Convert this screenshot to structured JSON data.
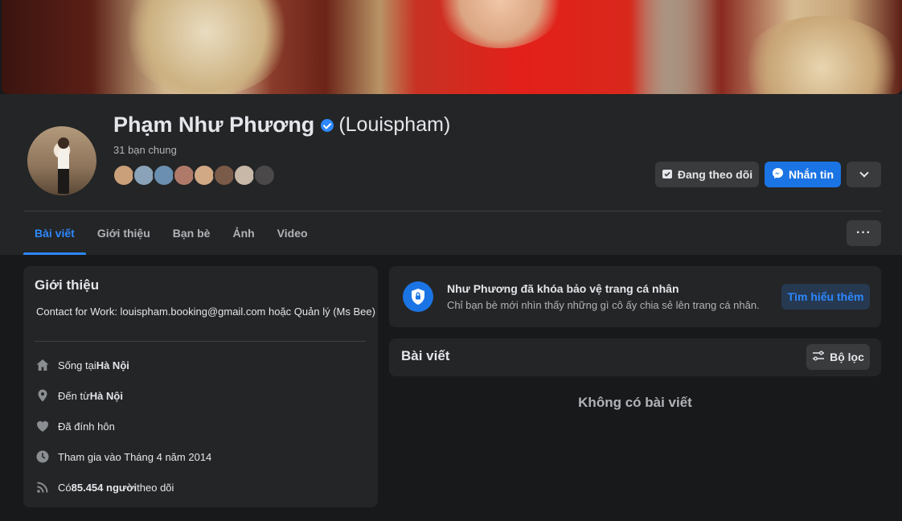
{
  "profile": {
    "name": "Phạm Như Phương",
    "alternate_name": "(Louispham)",
    "mutual_friends": "31 bạn chung",
    "mutual_avatars": [
      "#c9a07a",
      "#8aa3b8",
      "#6b8fb0",
      "#b07a6a",
      "#d1a985",
      "#7a5a48",
      "#c8b8a8",
      "#4a4848"
    ]
  },
  "actions": {
    "follow_label": "Đang theo dõi",
    "message_label": "Nhắn tin"
  },
  "tabs": [
    {
      "label": "Bài viết"
    },
    {
      "label": "Giới thiệu"
    },
    {
      "label": "Bạn bè"
    },
    {
      "label": "Ảnh"
    },
    {
      "label": "Video"
    }
  ],
  "tab_more_label": "···",
  "intro": {
    "title": "Giới thiệu",
    "bio": "Contact for Work: louispham.booking@gmail.com hoặc Quản lý (Ms Bee)",
    "items": [
      {
        "icon": "home-icon",
        "prefix": "Sống tại ",
        "bold": "Hà Nội",
        "suffix": ""
      },
      {
        "icon": "location-pin-icon",
        "prefix": "Đến từ ",
        "bold": "Hà Nội",
        "suffix": ""
      },
      {
        "icon": "heart-icon",
        "prefix": "Đã đính hôn",
        "bold": "",
        "suffix": ""
      },
      {
        "icon": "clock-icon",
        "prefix": "Tham gia vào Tháng 4 năm 2014",
        "bold": "",
        "suffix": ""
      },
      {
        "icon": "rss-icon",
        "prefix": "Có ",
        "bold": "85.454 người",
        "suffix": " theo dõi"
      }
    ]
  },
  "locked_notice": {
    "title": "Như Phương đã khóa bảo vệ trang cá nhân",
    "subtitle": "Chỉ bạn bè mới nhìn thấy những gì cô ấy chia sẻ lên trang cá nhân.",
    "button_label": "Tìm hiểu thêm"
  },
  "posts": {
    "title": "Bài viết",
    "filter_label": "Bộ lọc",
    "empty_label": "Không có bài viết"
  },
  "colors": {
    "accent": "#2d88ff",
    "primary_button": "#1b74e4",
    "card_bg": "#242526",
    "page_bg": "#18191a"
  }
}
